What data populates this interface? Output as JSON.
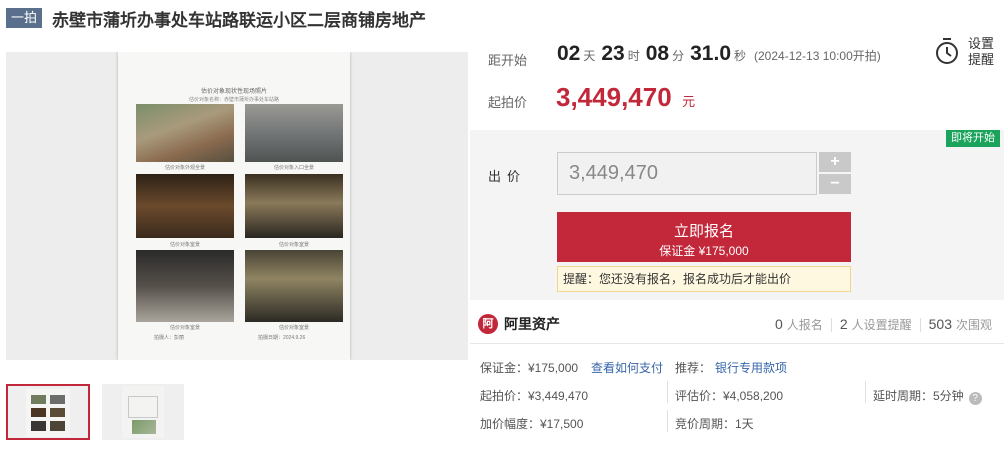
{
  "title": {
    "tag": "一拍",
    "text": "赤壁市蒲圻办事处车站路联运小区二层商铺房地产"
  },
  "gallery": {
    "doc": {
      "heading": "估价对象现状性现场照片",
      "subheading": "估价对象名称：赤壁市蒲圻办事处车站路",
      "captions": [
        "估价对象外观全景",
        "估价对象入口全景",
        "估价对象室景",
        "估价对象室景",
        "估价对象室景",
        "估价对象室景"
      ],
      "footer_left": "拍摄人：彭丽",
      "footer_right": "拍摄日期：2024.9.26"
    }
  },
  "countdown": {
    "label": "距开始",
    "days": "02",
    "days_unit": "天",
    "hours": "23",
    "hours_unit": "时",
    "minutes": "08",
    "minutes_unit": "分",
    "seconds": "31.0",
    "seconds_unit": "秒",
    "open_time": "(2024-12-13 10:00开拍)"
  },
  "start_price": {
    "label": "起拍价",
    "value": "3,449,470",
    "unit": "元"
  },
  "reminder": {
    "label": "设置提醒"
  },
  "bid": {
    "badge": "即将开始",
    "label": "出价",
    "input_value": "3,449,470",
    "plus": "+",
    "minus": "−",
    "signup_label": "立即报名",
    "signup_deposit": "保证金 ¥175,000",
    "notice": "提醒：您还没有报名，报名成功后才能出价"
  },
  "platform": {
    "logo_mark": "阿",
    "name": "阿里资产"
  },
  "stats": [
    {
      "num": "0",
      "label": "人报名"
    },
    {
      "num": "2",
      "label": "人设置提醒"
    },
    {
      "num": "503",
      "label": "次围观"
    }
  ],
  "info": {
    "deposit": "保证金：¥175,000",
    "how_to_pay": "查看如何支付",
    "recommend_label": "推荐：",
    "recommend_link": "银行专用款项",
    "start_price": "起拍价：¥3,449,470",
    "appraisal": "评估价：¥4,058,200",
    "delay": "延时周期：5分钟",
    "increment": "加价幅度：¥17,500",
    "bid_period": "竞价周期：1天"
  },
  "colors": {
    "accent": "#c3273a",
    "badge_green": "#1aa35a",
    "link": "#3866a8",
    "title_tag": "#5a6f8c"
  }
}
